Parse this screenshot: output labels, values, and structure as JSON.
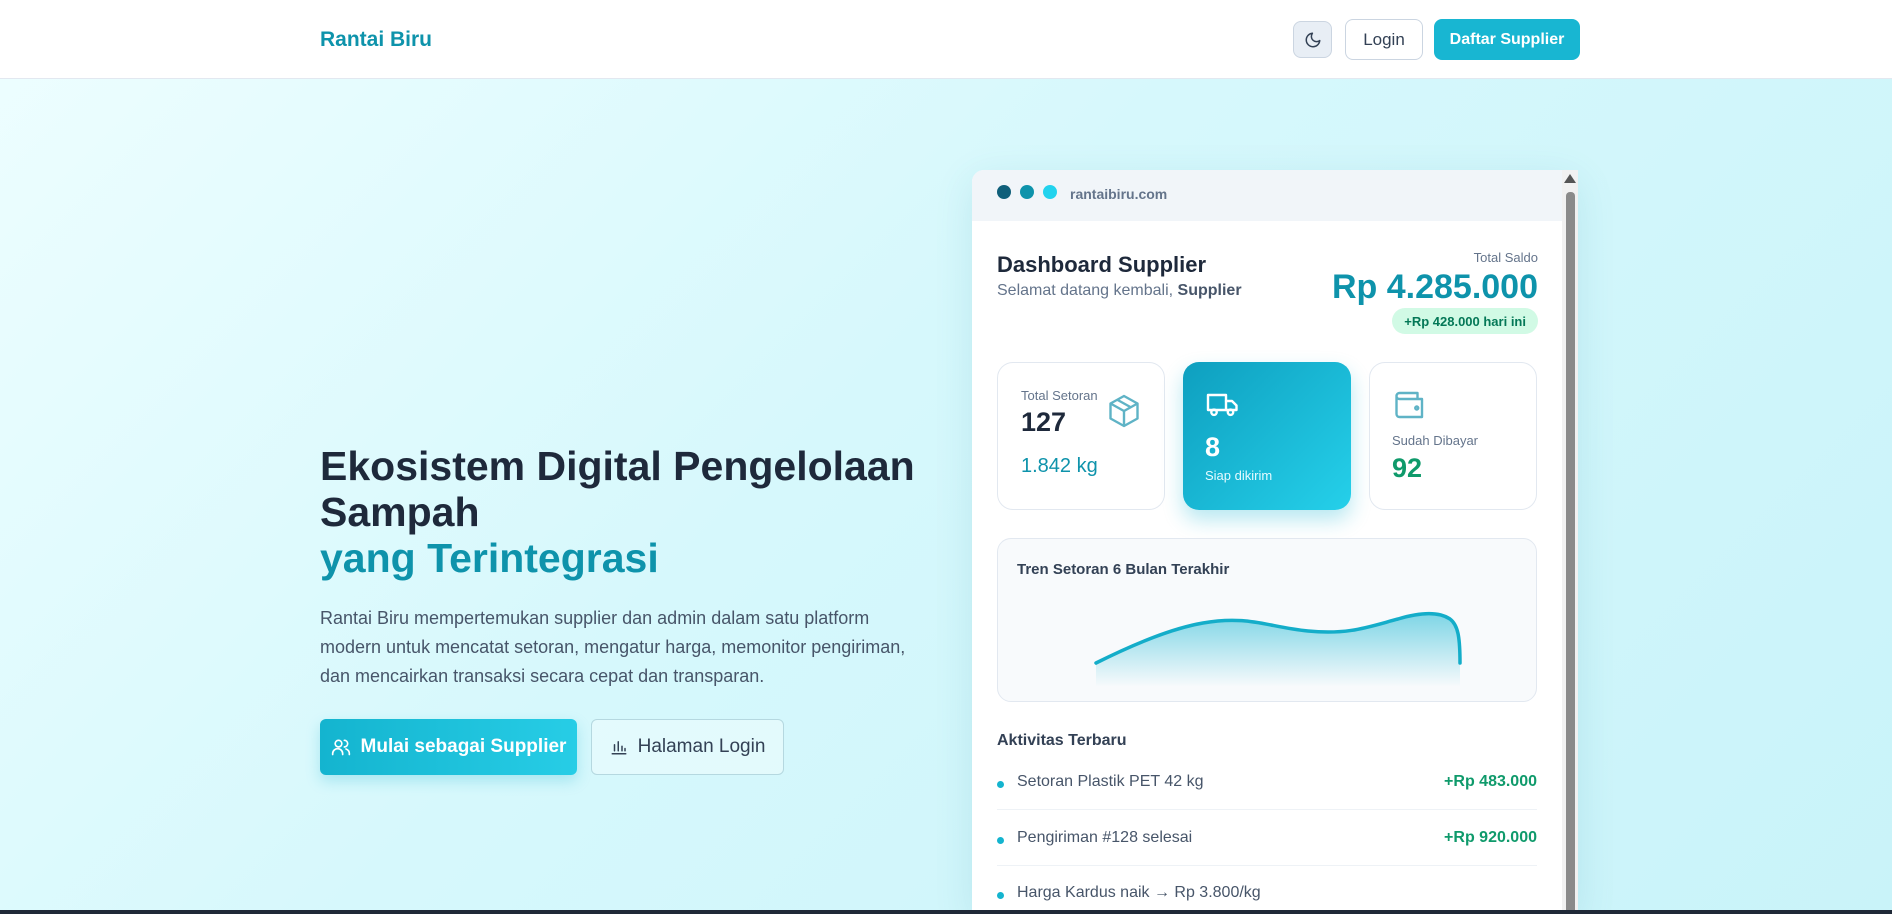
{
  "header": {
    "brand": "Rantai Biru",
    "theme_icon": "moon-icon",
    "login_label": "Login",
    "register_label": "Daftar Supplier"
  },
  "hero": {
    "title_line1": "Ekosistem Digital Pengelolaan Sampah",
    "title_accent": "yang Terintegrasi",
    "description": "Rantai Biru mempertemukan supplier dan admin dalam satu platform modern untuk mencatat setoran, mengatur harga, memonitor pengiriman, dan mencairkan transaksi secara cepat dan transparan.",
    "cta_primary": "Mulai sebagai Supplier",
    "cta_primary_icon": "users-icon",
    "cta_secondary": "Halaman Login",
    "cta_secondary_icon": "bar-chart-icon"
  },
  "mockup": {
    "url": "rantaibiru.com",
    "dot_colors": [
      "#0f5f7a",
      "#0e93ab",
      "#22d3ee"
    ],
    "dashboard_title": "Dashboard Supplier",
    "welcome_prefix": "Selamat datang kembali, ",
    "welcome_name": "Supplier",
    "saldo_label": "Total Saldo",
    "saldo_value": "Rp 4.285.000",
    "saldo_change": "+Rp 428.000 hari ini",
    "stats": [
      {
        "label": "Total Setoran",
        "value": "127",
        "sub": "1.842 kg",
        "icon": "box-icon"
      },
      {
        "label": "Siap dikirim",
        "value": "8",
        "icon": "truck-icon"
      },
      {
        "label": "Sudah Dibayar",
        "value": "92",
        "icon": "wallet-icon"
      }
    ],
    "chart_title": "Tren Setoran 6 Bulan Terakhir",
    "activity_title": "Aktivitas Terbaru",
    "activities": [
      {
        "label": "Setoran Plastik PET 42 kg",
        "amount": "+Rp 483.000"
      },
      {
        "label": "Pengiriman #128 selesai",
        "amount": "+Rp 920.000"
      },
      {
        "label": "Harga Kardus naik → Rp 3.800/kg",
        "amount": ""
      }
    ]
  },
  "colors": {
    "accent": "#0e93ab",
    "button": "#18b6d2",
    "positive": "#0f9a6b"
  }
}
